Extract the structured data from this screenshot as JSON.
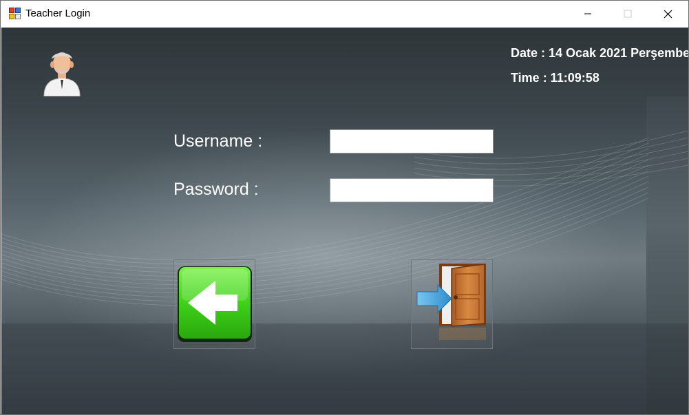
{
  "window": {
    "title": "Teacher Login",
    "controls": {
      "minimize": "minimize",
      "maximize": "maximize",
      "close": "close"
    }
  },
  "header": {
    "date_text": "Date : 14 Ocak 2021 Perşembe",
    "time_text": "Time : 11:09:58"
  },
  "form": {
    "username_label": "Username :",
    "username_value": "",
    "password_label": "Password :",
    "password_value": ""
  },
  "buttons": {
    "back": {
      "icon": "arrow-left-icon"
    },
    "login": {
      "icon": "door-enter-icon"
    }
  },
  "colors": {
    "text": "#ffffff",
    "background_dark": "#2e3539",
    "background_light": "#6f7b81",
    "back_button_green": "#3fd11a",
    "door_brown": "#c8772f",
    "arrow_blue": "#3ba0d8"
  }
}
